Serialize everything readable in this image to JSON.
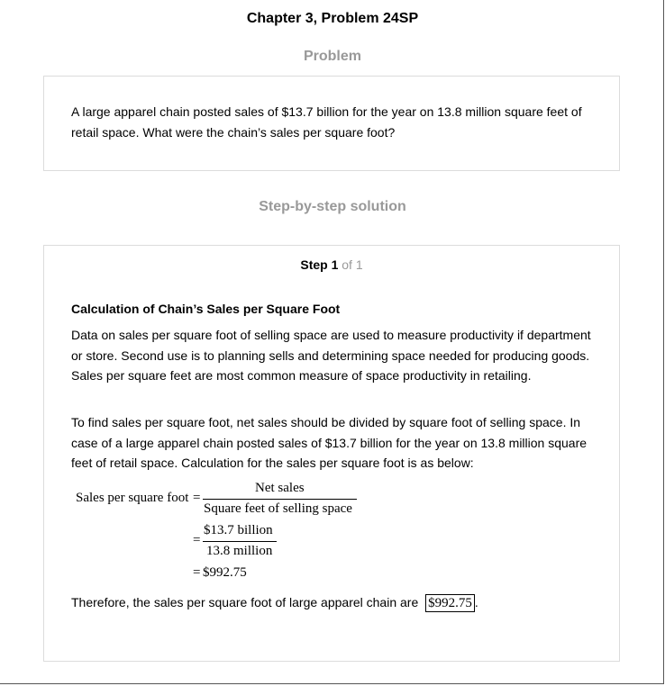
{
  "header": {
    "title": "Chapter 3, Problem 24SP"
  },
  "problem": {
    "heading": "Problem",
    "text": "A large apparel chain posted sales of $13.7 billion for the year on 13.8 million square feet of retail space. What were the chain’s sales per square foot?"
  },
  "solution": {
    "heading": "Step-by-step solution",
    "step_label": "Step 1",
    "step_of": "of 1",
    "calc_heading": "Calculation of Chain’s Sales per Square Foot",
    "para1": "Data on sales per square foot of selling space are used to measure productivity if department or store. Second use is to planning sells and determining space needed for producing goods. Sales per square feet are most common measure of space productivity in retailing.",
    "para2": "To find sales per square foot, net sales should be divided by square foot of selling space. In case of a large apparel chain posted sales of $13.7 billion for the year on 13.8 million square feet of retail space. Calculation for the sales per square foot is as below:",
    "formula": {
      "lhs": "Sales per square foot",
      "eq": "=",
      "num1": "Net sales",
      "den1": "Square feet of selling space",
      "num2": "$13.7 billion",
      "den2": "13.8 million",
      "result": "$992.75"
    },
    "conclusion_text": "Therefore, the sales per square foot of large apparel chain are",
    "answer": "$992.75",
    "period": "."
  }
}
